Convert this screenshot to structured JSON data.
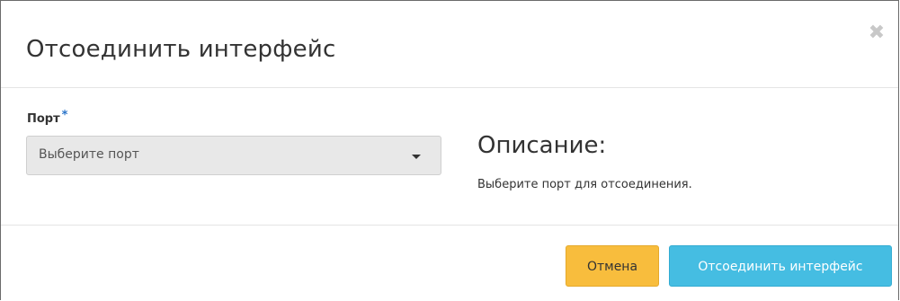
{
  "dialog": {
    "title": "Отсоединить интерфейс",
    "close_symbol": "✖"
  },
  "form": {
    "port_label": "Порт",
    "required_mark": "*",
    "port_select_value": "Выберите порт"
  },
  "description": {
    "heading": "Описание:",
    "text": "Выберите порт для отсоединения."
  },
  "footer": {
    "cancel_label": "Отмена",
    "submit_label": "Отсоединить интерфейс"
  },
  "colors": {
    "cancel_button": "#f8bd3d",
    "submit_button": "#45bde2",
    "required_star": "#2a74c9"
  },
  "icons": {
    "close": "close-icon",
    "dropdown": "caret-down-icon"
  }
}
